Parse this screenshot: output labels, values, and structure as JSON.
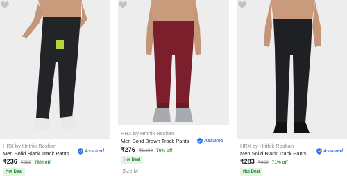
{
  "products": [
    {
      "brand": "HRX by Hrithik Roshan",
      "title": "Men Solid Black Track Pants",
      "price": "₹236",
      "mrp": "₹999",
      "discount": "76% off",
      "badge": "Hot Deal",
      "assured": "Assured",
      "pants_color": "#222428"
    },
    {
      "brand": "HRX by Hrithik Roshan",
      "title": "Men Solid Brown Track Pants",
      "price": "₹276",
      "mrp": "₹1,199",
      "discount": "76% off",
      "badge": "Hot Deal",
      "assured": "Assured",
      "size": "Size M",
      "pants_color": "#7a1f2b"
    },
    {
      "brand": "HRX by Hrithik Roshan",
      "title": "Men Solid Black Track Pants",
      "price": "₹283",
      "mrp": "₹999",
      "discount": "71% off",
      "badge": "Hot Deal",
      "assured": "Assured",
      "pants_color": "#1f2024"
    }
  ],
  "colors": {
    "discount_green": "#388e3c",
    "assured_blue": "#2874f0",
    "deal_bg": "#e6f4e4"
  }
}
